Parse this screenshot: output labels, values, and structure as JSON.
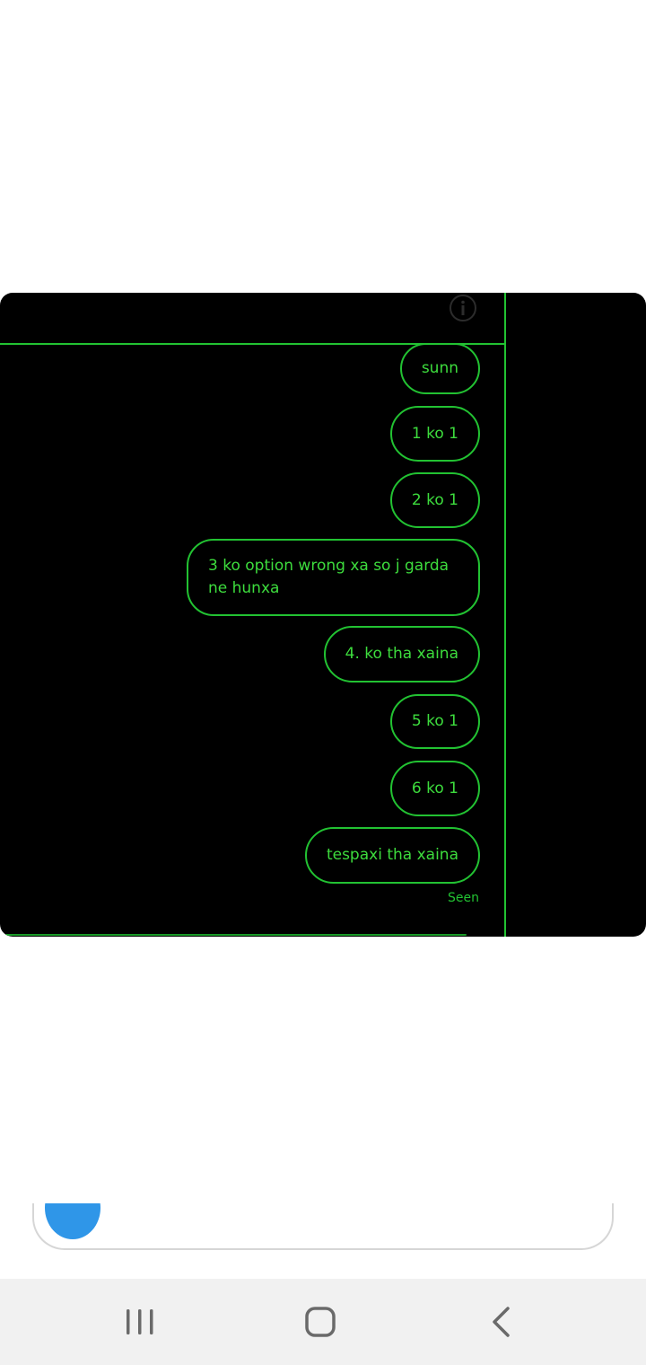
{
  "screenshot": {
    "theme": {
      "background": "#000000",
      "accent": "#22c232",
      "text": "#3ddc3d"
    },
    "header": {
      "icon": "info-icon"
    },
    "messages": [
      {
        "text": "sunn"
      },
      {
        "text": "1 ko 1"
      },
      {
        "text": "2 ko 1"
      },
      {
        "text": "3 ko option wrong xa so j garda ne hunxa"
      },
      {
        "text": "4. ko tha xaina"
      },
      {
        "text": "5 ko 1"
      },
      {
        "text": "6 ko 1"
      },
      {
        "text": "tespaxi tha xaina"
      }
    ],
    "status": "Seen"
  },
  "navigation_bar": {
    "background": "#f1f1f1",
    "buttons": [
      "recent-apps-icon",
      "home-icon",
      "back-icon"
    ]
  }
}
